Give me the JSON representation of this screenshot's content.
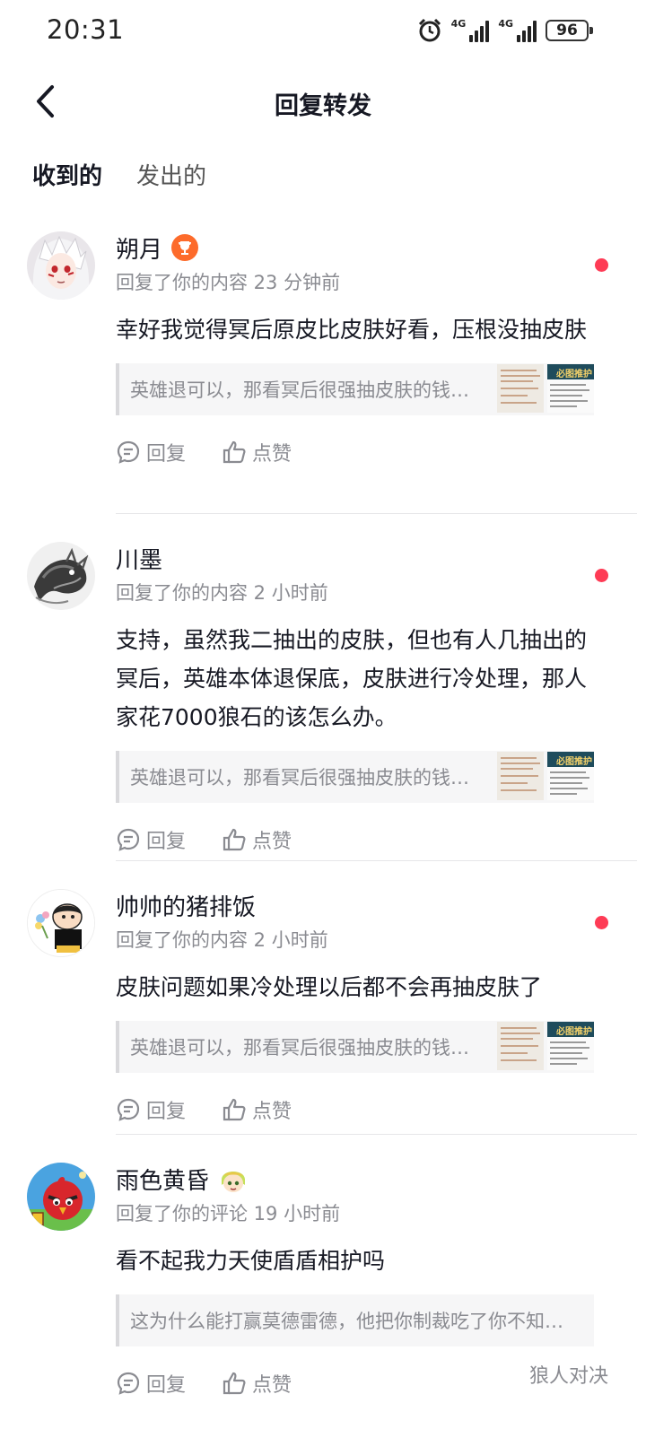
{
  "status_bar": {
    "time": "20:31",
    "signal1": "4G",
    "signal2": "4G",
    "battery": "96"
  },
  "header": {
    "title": "回复转发"
  },
  "tabs": [
    {
      "label": "收到的",
      "active": true
    },
    {
      "label": "发出的",
      "active": false
    }
  ],
  "thumbs": {
    "banner_text": "必图推护"
  },
  "notifications": [
    {
      "username": "朔月",
      "badge": "trophy-icon",
      "meta": "回复了你的内容 23 分钟前",
      "text": "幸好我觉得冥后原皮比皮肤好看，压根没抽皮肤",
      "quote": "英雄退可以，那看冥后很强抽皮肤的钱怎么办",
      "unread": true,
      "reply_label": "回复",
      "like_label": "点赞"
    },
    {
      "username": "川墨",
      "meta": "回复了你的内容 2 小时前",
      "text": "支持，虽然我二抽出的皮肤，但也有人几抽出的冥后，英雄本体退保底，皮肤进行冷处理，那人家花7000狼石的该怎么办。",
      "quote": "英雄退可以，那看冥后很强抽皮肤的钱怎么办",
      "unread": true,
      "reply_label": "回复",
      "like_label": "点赞"
    },
    {
      "username": "帅帅的猪排饭",
      "meta": "回复了你的内容 2 小时前",
      "text": "皮肤问题如果冷处理以后都不会再抽皮肤了",
      "quote": "英雄退可以，那看冥后很强抽皮肤的钱怎么办",
      "unread": true,
      "reply_label": "回复",
      "like_label": "点赞"
    },
    {
      "username": "雨色黄昏",
      "badge": "cartoon-face-icon",
      "meta": "回复了你的评论 19 小时前",
      "text": "看不起我力天使盾盾相护吗",
      "quote": "这为什么能打赢莫德雷德，他把你制裁吃了你不知道吗",
      "unread": false,
      "reply_label": "回复",
      "like_label": "点赞",
      "source": "狼人对决"
    }
  ]
}
